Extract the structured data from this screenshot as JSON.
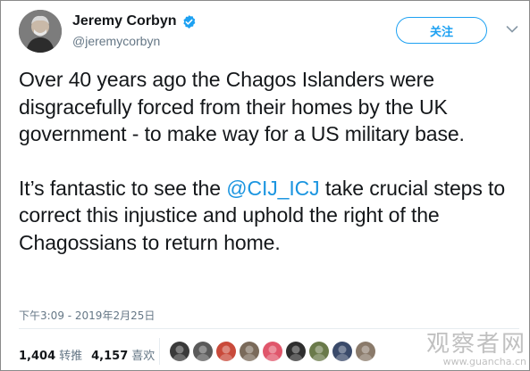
{
  "author": {
    "name": "Jeremy Corbyn",
    "handle": "@jeremycorbyn",
    "verified": true
  },
  "follow_label": "关注",
  "tweet": {
    "paragraph1": "Over 40 years ago the Chagos Islanders were disgracefully forced from their homes by the UK government - to make way for a US military base.",
    "p2_before": "It’s fantastic to see the ",
    "p2_mention": "@CIJ_ICJ",
    "p2_after": " take crucial steps to correct this injustice and uphold the right of the Chagossians to return home."
  },
  "timestamp": "下午3:09 - 2019年2月25日",
  "stats": {
    "retweets_count": "1,404",
    "retweets_label": "转推",
    "likes_count": "4,157",
    "likes_label": "喜欢"
  },
  "liker_avatar_colors": [
    "#3a3a3a",
    "#5a5a5a",
    "#c94a3a",
    "#7a6a5a",
    "#e0566b",
    "#2e2e2e",
    "#6a7a4a",
    "#3a4a6a",
    "#8a7a6a"
  ],
  "watermark": {
    "text": "观察者网",
    "url": "www.guancha.cn"
  },
  "colors": {
    "accent": "#1da1f2",
    "mention": "#1b95e0",
    "muted": "#657786"
  }
}
